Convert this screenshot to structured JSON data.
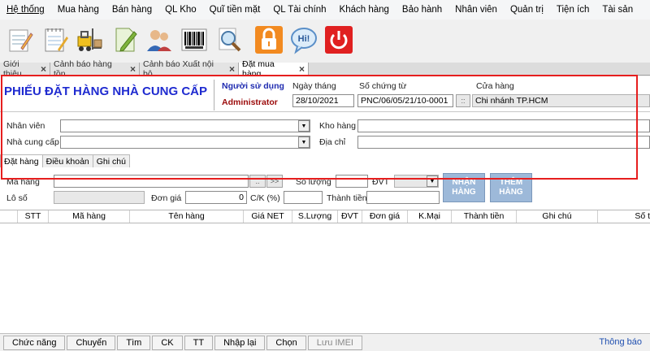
{
  "menu": [
    "Hệ thống",
    "Mua hàng",
    "Bán hàng",
    "QL Kho",
    "Quĩ tiền mặt",
    "QL Tài chính",
    "Khách hàng",
    "Bảo hành",
    "Nhân viên",
    "Quản trị",
    "Tiện ích",
    "Tài sản"
  ],
  "toolbar_icons": [
    "notepad-icon",
    "notebook-icon",
    "forklift-icon",
    "edit-document-icon",
    "users-icon",
    "barcode-icon",
    "magnifier-icon",
    "lock-icon",
    "chat-icon",
    "power-icon"
  ],
  "tabs": [
    {
      "label": "Giới thiệu"
    },
    {
      "label": "Cảnh báo hàng tồn"
    },
    {
      "label": "Cảnh báo Xuất nội bộ"
    },
    {
      "label": "Đặt mua hàng"
    }
  ],
  "form": {
    "title": "PHIẾU ĐẶT HÀNG NHÀ CUNG CẤP",
    "user_label": "Người sử dụng",
    "user_value": "Administrator",
    "date_label": "Ngày tháng",
    "date_value": "28/10/2021",
    "doc_label": "Số chứng từ",
    "doc_value": "PNC/06/05/21/10-0001",
    "store_label": "Cửa hàng",
    "store_btn": "::",
    "store_value": "Chi nhánh TP.HCM",
    "employee_label": "Nhân viên",
    "supplier_label": "Nhà cung cấp",
    "warehouse_label": "Kho hàng",
    "address_label": "Địa chỉ"
  },
  "subtabs": [
    "Đặt hàng",
    "Điều khoản",
    "Ghi chú"
  ],
  "entry": {
    "item_code_label": "Mã hàng",
    "lot_label": "Lô số",
    "qty_label": "Số lượng",
    "unit_label": "ĐVT",
    "price_label": "Đơn giá",
    "price_value": "0",
    "discount_label": "C/K (%)",
    "amount_label": "Thành tiền",
    "btn_dots": "..",
    "btn_arrows": ">>",
    "receive_btn": "NHẬN HÀNG",
    "add_btn": "THÊM HÀNG"
  },
  "grid_columns": [
    "STT",
    "Mã hàng",
    "Tên hàng",
    "Giá NET",
    "S.Lượng",
    "ĐVT",
    "Đơn giá",
    "K.Mại",
    "Thành tiền",
    "Ghi chú",
    "Số t"
  ],
  "statusbar": {
    "buttons": [
      "Chức năng",
      "Chuyển",
      "Tìm",
      "CK",
      "TT",
      "Nhập lại",
      "Chọn",
      "Lưu IMEI"
    ],
    "notify": "Thông báo"
  }
}
